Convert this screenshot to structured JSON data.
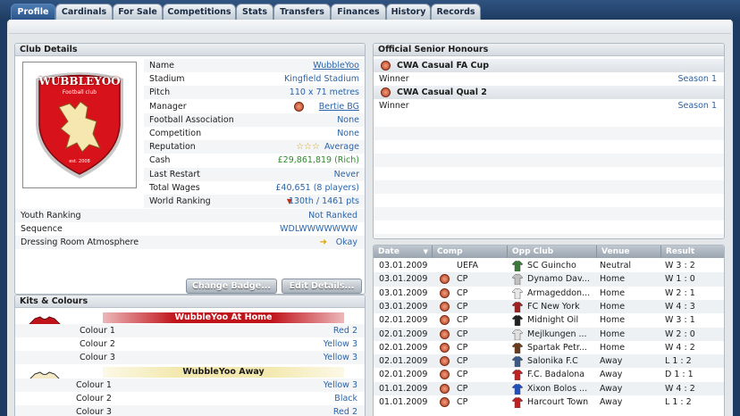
{
  "tabs": [
    "Profile",
    "Cardinals",
    "For Sale",
    "Competitions",
    "Stats",
    "Transfers",
    "Finances",
    "History",
    "Records"
  ],
  "club_details": {
    "title": "Club Details",
    "crest_text": "WUBBLEYOO",
    "crest_sub": "Football club",
    "crest_est": "est. 2008",
    "rows": [
      {
        "label": "Name",
        "value": "WubbleYoo"
      },
      {
        "label": "Stadium",
        "value": "Kingfield Stadium"
      },
      {
        "label": "Pitch",
        "value": "110 x 71 metres"
      },
      {
        "label": "Manager",
        "value": "Bertie BG"
      },
      {
        "label": "Football Association",
        "value": "None"
      },
      {
        "label": "Competition",
        "value": "None"
      },
      {
        "label": "Reputation",
        "value": "Average",
        "stars": "☆☆☆"
      },
      {
        "label": "Cash",
        "value": "£29,861,819 (Rich)"
      },
      {
        "label": "Last Restart",
        "value": "Never"
      },
      {
        "label": "Total Wages",
        "value": "£40,651 (8 players)"
      },
      {
        "label": "World Ranking",
        "value": "130th / 1461 pts"
      }
    ],
    "wide_rows": [
      {
        "label": "Youth Ranking",
        "value": "Not Ranked"
      },
      {
        "label": "Sequence",
        "value": "WDLWWWWWWW"
      },
      {
        "label": "Dressing Room Atmosphere",
        "value": "Okay"
      }
    ],
    "buttons": {
      "change_badge": "Change Badge...",
      "edit_details": "Edit Details..."
    }
  },
  "kits": {
    "title": "Kits & Colours",
    "home": {
      "name": "WubbleYoo At Home",
      "colours": [
        {
          "label": "Colour 1",
          "value": "Red 2"
        },
        {
          "label": "Colour 2",
          "value": "Yellow 3"
        },
        {
          "label": "Colour 3",
          "value": "Yellow 3"
        }
      ]
    },
    "away": {
      "name": "WubbleYoo Away",
      "colours": [
        {
          "label": "Colour 1",
          "value": "Yellow 3"
        },
        {
          "label": "Colour 2",
          "value": "Black"
        },
        {
          "label": "Colour 3",
          "value": "Red 2"
        }
      ]
    }
  },
  "honours": {
    "title": "Official Senior Honours",
    "items": [
      {
        "name": "CWA Casual FA Cup",
        "result": "Winner",
        "season": "Season 1"
      },
      {
        "name": "CWA Casual Qual 2",
        "result": "Winner",
        "season": "Season 1"
      }
    ]
  },
  "fixtures": {
    "headers": [
      "Date",
      "Comp",
      "Opp Club",
      "Venue",
      "Result"
    ],
    "rows": [
      {
        "date": "03.01.2009",
        "comp": "UEFA",
        "opp": "SC Guincho",
        "venue": "Neutral",
        "result": "W 3 : 2"
      },
      {
        "date": "03.01.2009",
        "comp": "CP",
        "opp": "Dynamo Dav...",
        "venue": "Home",
        "result": "W 1 : 0"
      },
      {
        "date": "03.01.2009",
        "comp": "CP",
        "opp": "Armageddon...",
        "venue": "Home",
        "result": "W 2 : 1"
      },
      {
        "date": "03.01.2009",
        "comp": "CP",
        "opp": "FC New York",
        "venue": "Home",
        "result": "W 4 : 3"
      },
      {
        "date": "02.01.2009",
        "comp": "CP",
        "opp": "Midnight Oil",
        "venue": "Home",
        "result": "W 3 : 1"
      },
      {
        "date": "02.01.2009",
        "comp": "CP",
        "opp": "Mejlkungen ...",
        "venue": "Home",
        "result": "W 2 : 0"
      },
      {
        "date": "02.01.2009",
        "comp": "CP",
        "opp": "Spartak Petr...",
        "venue": "Home",
        "result": "W 4 : 2"
      },
      {
        "date": "02.01.2009",
        "comp": "CP",
        "opp": "Salonika F.C",
        "venue": "Away",
        "result": "L 1 : 2"
      },
      {
        "date": "02.01.2009",
        "comp": "CP",
        "opp": "F.C. Badalona",
        "venue": "Away",
        "result": "D 1 : 1"
      },
      {
        "date": "01.01.2009",
        "comp": "CP",
        "opp": "Xixon Bolos ...",
        "venue": "Away",
        "result": "W 4 : 2"
      },
      {
        "date": "01.01.2009",
        "comp": "CP",
        "opp": "Harcourt Town",
        "venue": "Away",
        "result": "L 1 : 2"
      }
    ]
  },
  "colors": {
    "accent": "#2a64a8",
    "green": "#2f8a2a",
    "home_bar": "#c0141b",
    "away_bar": "#f3e9b0"
  }
}
